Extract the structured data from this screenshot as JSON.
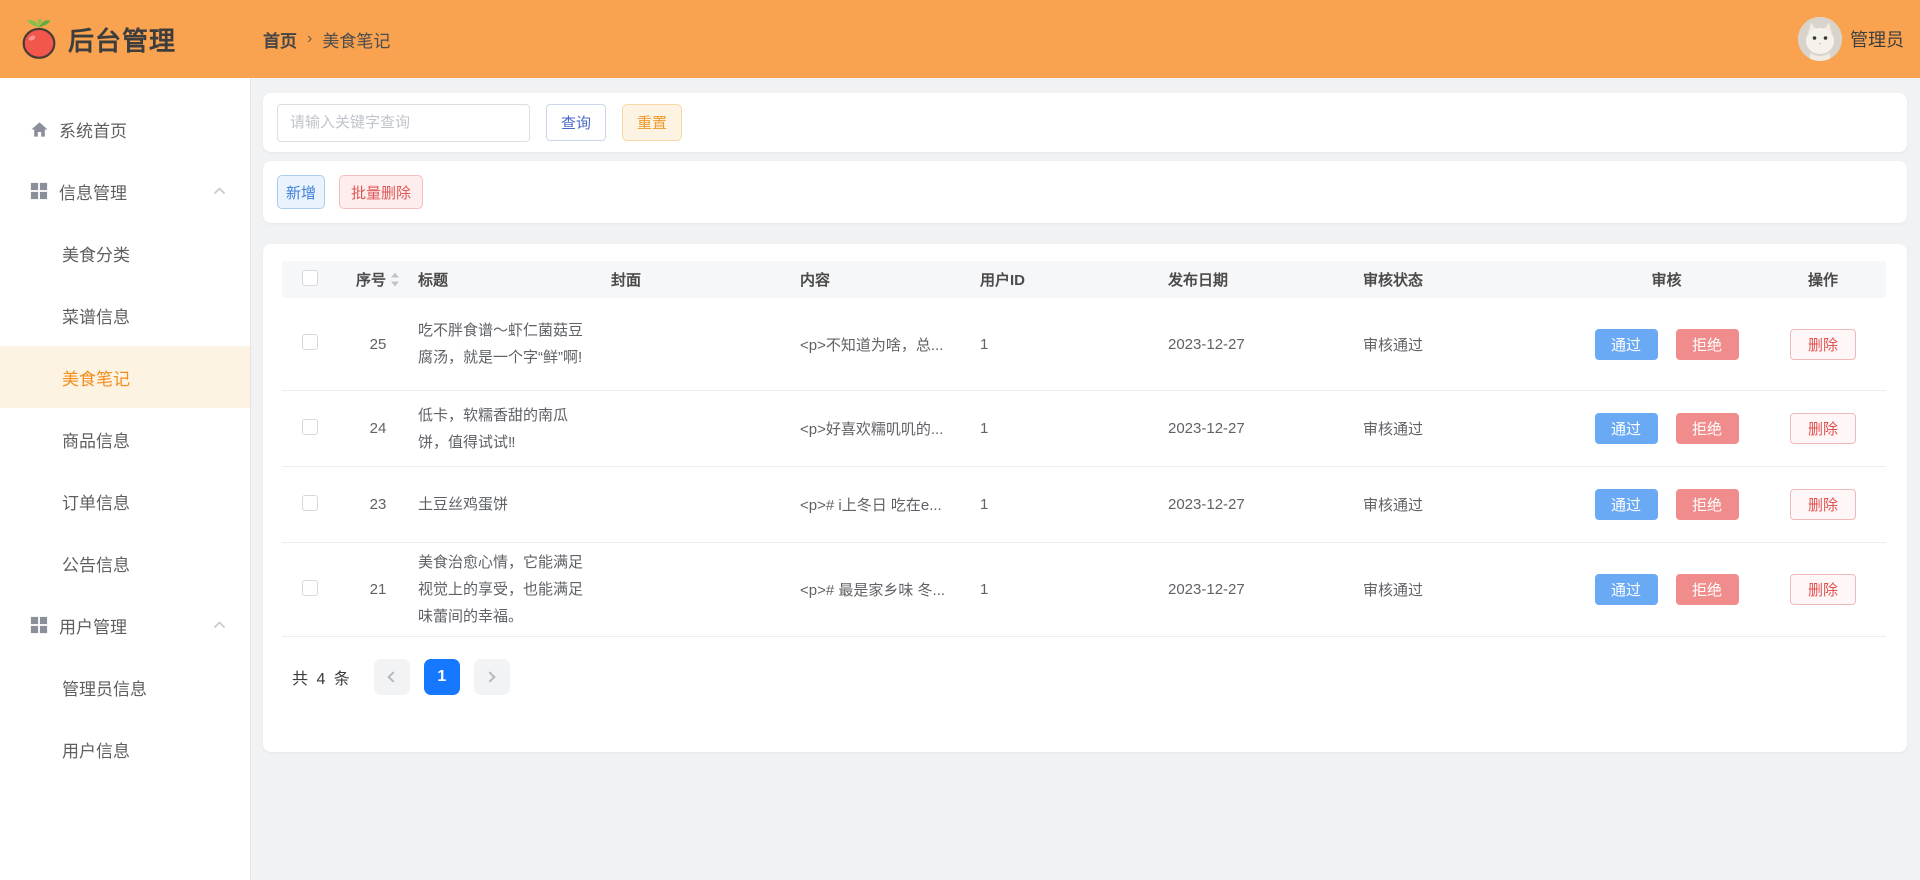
{
  "header": {
    "app_title": "后台管理",
    "breadcrumb": {
      "home": "首页",
      "separator": "›",
      "current": "美食笔记"
    },
    "user": {
      "name": "管理员"
    }
  },
  "sidebar": {
    "items": [
      {
        "label": "系统首页",
        "icon": "home-icon",
        "type": "top"
      },
      {
        "label": "信息管理",
        "icon": "grid-icon",
        "type": "group",
        "expanded": true
      },
      {
        "label": "美食分类",
        "type": "sub"
      },
      {
        "label": "菜谱信息",
        "type": "sub"
      },
      {
        "label": "美食笔记",
        "type": "sub",
        "active": true
      },
      {
        "label": "商品信息",
        "type": "sub"
      },
      {
        "label": "订单信息",
        "type": "sub"
      },
      {
        "label": "公告信息",
        "type": "sub"
      },
      {
        "label": "用户管理",
        "icon": "grid-icon",
        "type": "group",
        "expanded": true
      },
      {
        "label": "管理员信息",
        "type": "sub"
      },
      {
        "label": "用户信息",
        "type": "sub"
      }
    ]
  },
  "search": {
    "placeholder": "请输入关键字查询",
    "query_label": "查询",
    "reset_label": "重置"
  },
  "toolbar": {
    "add_label": "新增",
    "batch_delete_label": "批量删除"
  },
  "table": {
    "columns": [
      "序号",
      "标题",
      "封面",
      "内容",
      "用户ID",
      "发布日期",
      "审核状态",
      "审核",
      "操作"
    ],
    "actions": {
      "approve": "通过",
      "reject": "拒绝",
      "delete": "删除"
    },
    "rows": [
      {
        "seq": "25",
        "title": "吃不胖食谱～虾仁菌菇豆腐汤，就是一个字“鲜”啊!",
        "cover_icon": "shrimp-mushroom-soup",
        "content": "<p>不知道为啥，总...",
        "user_id": "1",
        "date": "2023-12-27",
        "status": "审核通过"
      },
      {
        "seq": "24",
        "title": "低卡，软糯香甜的南瓜饼，值得试试‼",
        "cover_icon": "pumpkin-cakes",
        "content": "<p>好喜欢糯叽叽的...",
        "user_id": "1",
        "date": "2023-12-27",
        "status": "审核通过"
      },
      {
        "seq": "23",
        "title": "土豆丝鸡蛋饼",
        "cover_icon": "egg-pancakes",
        "content": "<p># i上冬日 吃在e...",
        "user_id": "1",
        "date": "2023-12-27",
        "status": "审核通过"
      },
      {
        "seq": "21",
        "title": "美食治愈心情，它能满足视觉上的享受，也能满足味蕾间的幸福。",
        "cover_icon": "veggie-rice-bowl",
        "content": "<p># 最是家乡味 冬...",
        "user_id": "1",
        "date": "2023-12-27",
        "status": "审核通过"
      }
    ]
  },
  "pagination": {
    "total_text": "共 4 条",
    "current_page": "1"
  },
  "colors": {
    "header_orange": "#F9A350",
    "active_menu_text": "#F18E1D",
    "active_menu_bg": "#FDF3E2",
    "approve_blue": "#6AA9F4",
    "reject_pink": "#F08C8C",
    "delete_red": "#E14F4F",
    "page_active_blue": "#1677FF"
  }
}
